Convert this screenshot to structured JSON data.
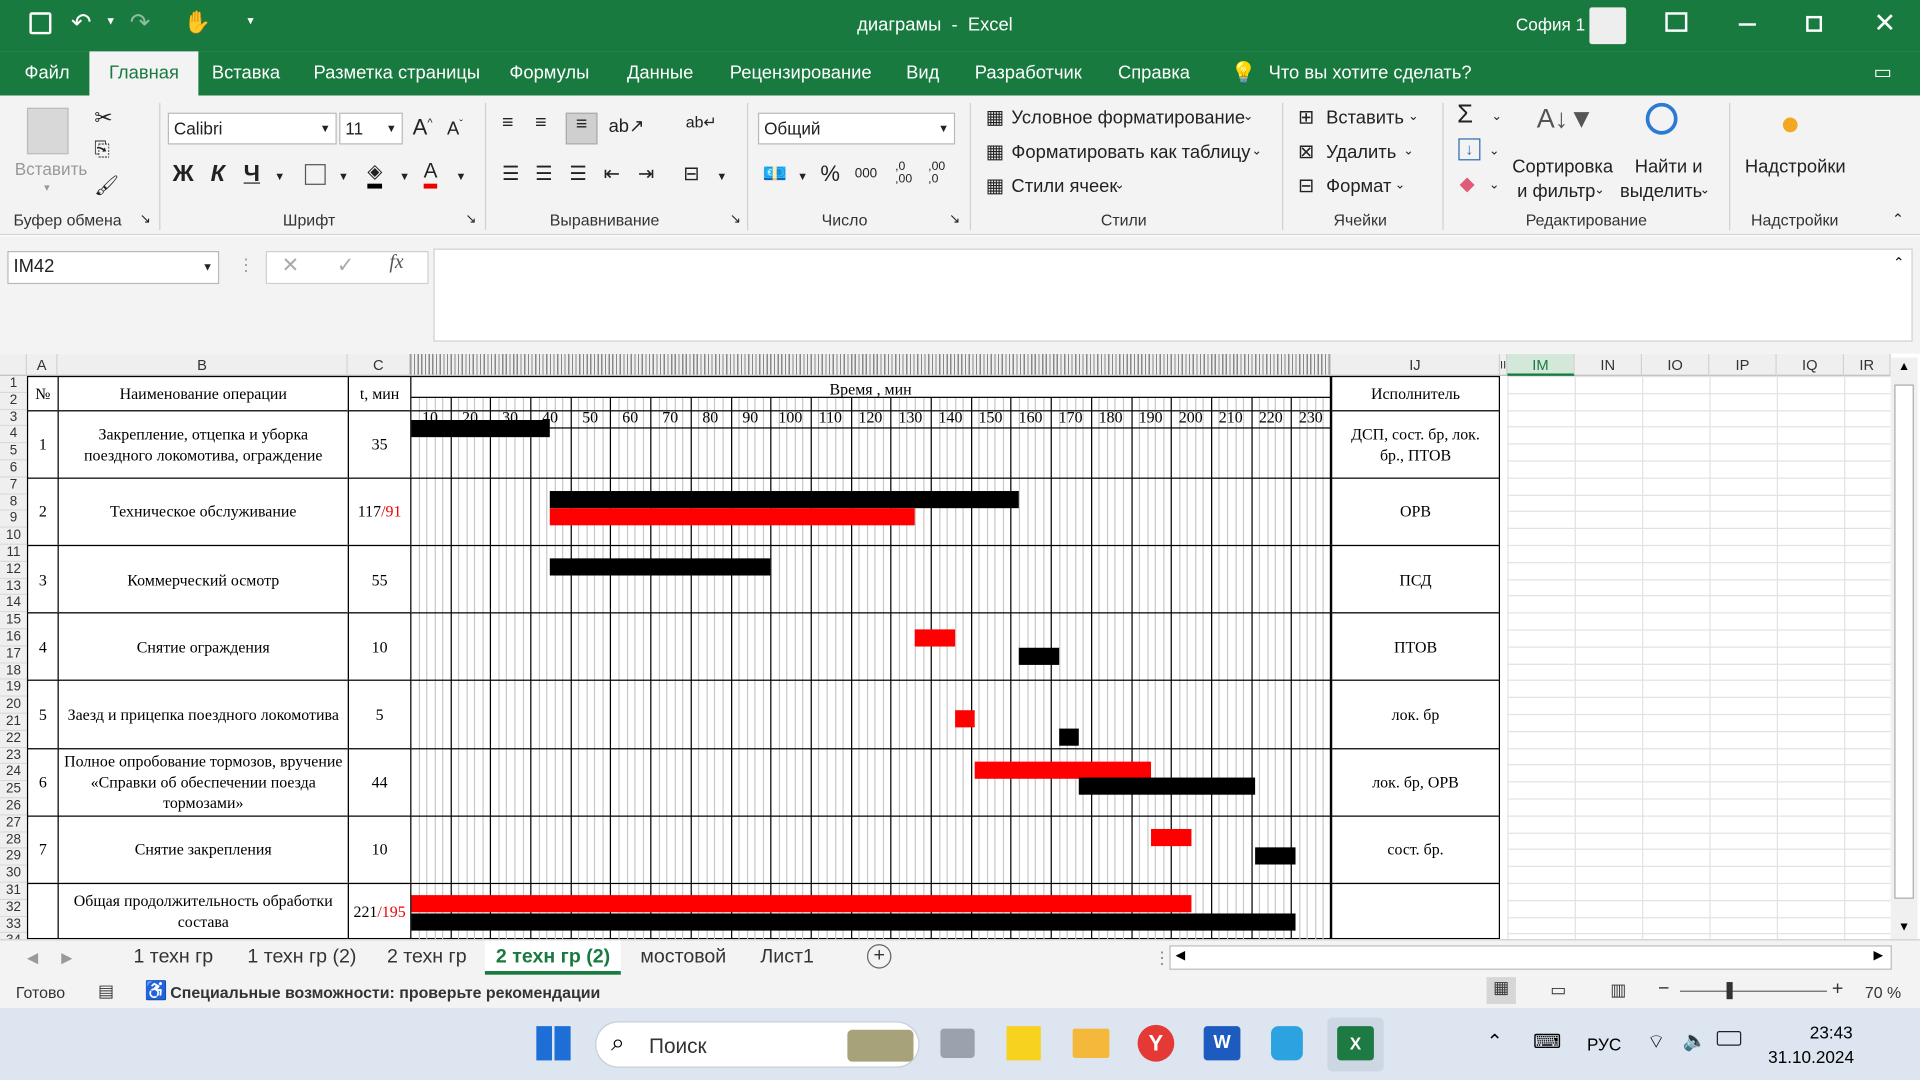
{
  "window": {
    "title": "диаграмы  -  Excel",
    "user": "София 1"
  },
  "menu": {
    "tabs": [
      "Файл",
      "Главная",
      "Вставка",
      "Разметка страницы",
      "Формулы",
      "Данные",
      "Рецензирование",
      "Вид",
      "Разработчик",
      "Справка"
    ],
    "active": "Главная",
    "tell_me": "Что вы хотите сделать?"
  },
  "ribbon": {
    "clipboard": {
      "paste": "Вставить",
      "label": "Буфер обмена"
    },
    "font": {
      "name": "Calibri",
      "size": "11",
      "bold": "Ж",
      "italic": "К",
      "underline": "Ч",
      "label": "Шрифт"
    },
    "alignment": {
      "label": "Выравнивание"
    },
    "number": {
      "format": "Общий",
      "label": "Число",
      "percent": "%",
      "thousands": "000",
      "inc": ",0 ,00",
      "dec": ",00 ,0"
    },
    "styles": {
      "conditional": "Условное форматирование",
      "as_table": "Форматировать как таблицу",
      "cell_styles": "Стили ячеек",
      "label": "Стили"
    },
    "cells": {
      "insert": "Вставить",
      "delete": "Удалить",
      "format": "Формат",
      "label": "Ячейки"
    },
    "editing": {
      "sort1": "Сортировка",
      "sort2": "и фильтр",
      "find1": "Найти и",
      "find2": "выделить",
      "label": "Редактирование"
    },
    "addins": {
      "button": "Надстройки",
      "label": "Надстройки"
    }
  },
  "formula_bar": {
    "name_box": "IM42",
    "fx": "fx",
    "value": ""
  },
  "columns": {
    "A": "A",
    "B": "B",
    "C": "C",
    "IJ": "IJ",
    "II": "II",
    "IM": "IM",
    "IN": "IN",
    "IO": "IO",
    "IP": "IP",
    "IQ": "IQ",
    "IR": "IR"
  },
  "rows": [
    "1",
    "2",
    "3",
    "4",
    "5",
    "6",
    "7",
    "8",
    "9",
    "10",
    "11",
    "12",
    "13",
    "14",
    "15",
    "16",
    "17",
    "18",
    "19",
    "20",
    "21",
    "22",
    "23",
    "24",
    "25",
    "26",
    "27",
    "28",
    "29",
    "30",
    "31",
    "32",
    "33",
    "34"
  ],
  "table": {
    "header": {
      "num": "№",
      "name": "Наименование операции",
      "t": "t, мин",
      "time": "Время , мин",
      "executor": "Исполнитель"
    },
    "ticks": [
      "10",
      "20",
      "30",
      "40",
      "50",
      "60",
      "70",
      "80",
      "90",
      "100",
      "110",
      "120",
      "130",
      "140",
      "150",
      "160",
      "170",
      "180",
      "190",
      "200",
      "210",
      "220",
      "230"
    ],
    "operations": [
      {
        "num": "1",
        "name": "Закрепление, отцепка и уборка поездного локомотива, ограждение",
        "t": "35",
        "t2": "",
        "executor": "ДСП, сост. бр, лок. бр., ПТОВ"
      },
      {
        "num": "2",
        "name": "Техническое обслуживание",
        "t": "117",
        "t2": "/91",
        "executor": "ОРВ"
      },
      {
        "num": "3",
        "name": "Коммерческий осмотр",
        "t": "55",
        "t2": "",
        "executor": "ПСД"
      },
      {
        "num": "4",
        "name": "Снятие ограждения",
        "t": "10",
        "t2": "",
        "executor": "ПТОВ"
      },
      {
        "num": "5",
        "name": "Заезд и прицепка поездного локомотива",
        "t": "5",
        "t2": "",
        "executor": "лок. бр"
      },
      {
        "num": "6",
        "name": "Полное опробование тормозов, вручение «Справки об обеспечении поезда тормозами»",
        "t": "44",
        "t2": "",
        "executor": "лок. бр, ОРВ"
      },
      {
        "num": "7",
        "name": "Снятие закрепления",
        "t": "10",
        "t2": "",
        "executor": "сост. бр."
      }
    ],
    "total": {
      "name": "Общая продолжительность обработки состава",
      "t": "221",
      "t2": "/195"
    }
  },
  "gantt_bars": [
    {
      "row": 1,
      "color": "black",
      "start": 0,
      "end": 35
    },
    {
      "row": 2,
      "color": "black",
      "start": 35,
      "end": 152
    },
    {
      "row": 2,
      "color": "red",
      "start": 35,
      "end": 126
    },
    {
      "row": 3,
      "color": "black",
      "start": 35,
      "end": 90
    },
    {
      "row": 4,
      "color": "red",
      "start": 126,
      "end": 136
    },
    {
      "row": 4,
      "color": "black",
      "start": 152,
      "end": 162
    },
    {
      "row": 5,
      "color": "red",
      "start": 136,
      "end": 141
    },
    {
      "row": 5,
      "color": "black",
      "start": 162,
      "end": 167
    },
    {
      "row": 6,
      "color": "red",
      "start": 141,
      "end": 185
    },
    {
      "row": 6,
      "color": "black",
      "start": 167,
      "end": 211
    },
    {
      "row": 7,
      "color": "red",
      "start": 185,
      "end": 195
    },
    {
      "row": 7,
      "color": "black",
      "start": 211,
      "end": 221
    },
    {
      "row": 8,
      "color": "red",
      "start": 0,
      "end": 195
    },
    {
      "row": 8,
      "color": "black",
      "start": 0,
      "end": 221
    }
  ],
  "sheets": [
    "1 техн гр",
    "1 техн гр (2)",
    "2 техн гр",
    "2 техн гр (2)",
    "мостовой",
    "Лист1"
  ],
  "active_sheet": "2 техн гр (2)",
  "status": {
    "ready": "Готово",
    "accessibility": "Специальные возможности: проверьте рекомендации",
    "zoom": "70 %"
  },
  "taskbar": {
    "search": "Поиск",
    "lang": "РУС",
    "time": "23:43",
    "date": "31.10.2024"
  },
  "colors": {
    "brand": "#187a3f",
    "bar_red": "#ff0000",
    "bar_black": "#000000"
  }
}
